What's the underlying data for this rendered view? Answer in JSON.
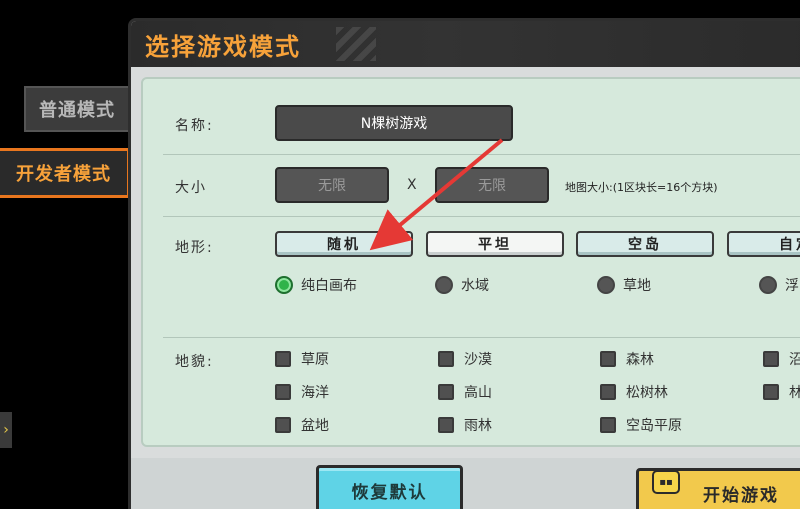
{
  "side_tabs": {
    "normal": "普通模式",
    "developer": "开发者模式"
  },
  "dialog": {
    "title": "选择游戏模式",
    "name": {
      "label": "名称:",
      "value": "N棵树游戏"
    },
    "size": {
      "label": "大小",
      "width": "无限",
      "separator": "X",
      "height": "无限",
      "hint": "地图大小:(1区块长=16个方块)"
    },
    "terrain": {
      "label": "地形:",
      "buttons": [
        "随机",
        "平坦",
        "空岛",
        "自定"
      ],
      "selected_button": "平坦",
      "options": [
        "纯白画布",
        "水域",
        "草地",
        "浮"
      ],
      "selected_option": "纯白画布"
    },
    "landform": {
      "label": "地貌:",
      "rows": [
        [
          "草原",
          "沙漠",
          "森林",
          "沼"
        ],
        [
          "海洋",
          "高山",
          "松树林",
          "林"
        ],
        [
          "盆地",
          "雨林",
          "空岛平原"
        ]
      ]
    }
  },
  "footer": {
    "reset": "恢复默认",
    "start": "开始游戏"
  },
  "colors": {
    "accent_orange": "#f7a23a",
    "selected_green": "#2fb34a",
    "arrow_red": "#e53935"
  },
  "icons": {
    "side_arrow": "chevron-right-icon",
    "start_game": "gamepad-icon"
  }
}
